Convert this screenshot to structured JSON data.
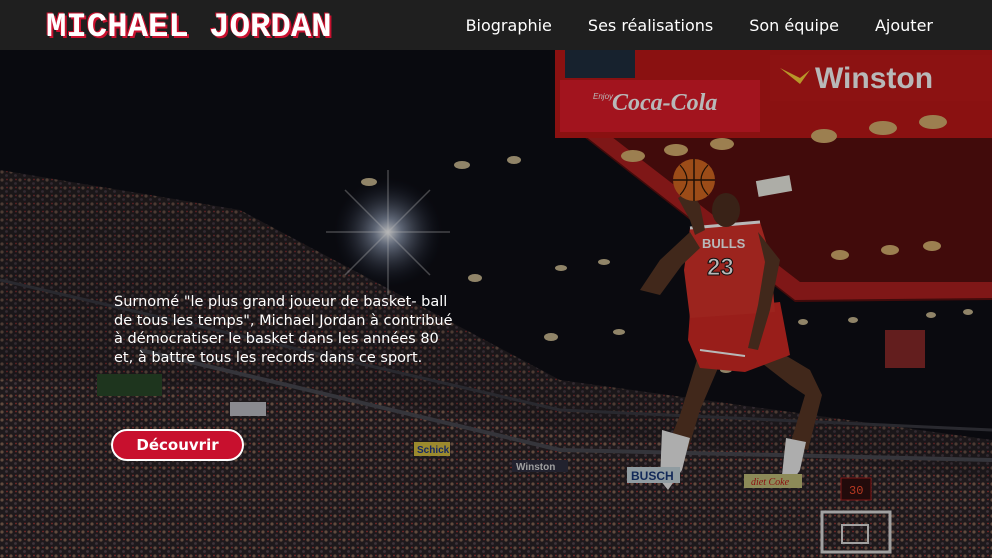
{
  "header": {
    "logo_text": "MICHAEL JORDAN",
    "nav": [
      {
        "label": "Biographie"
      },
      {
        "label": "Ses réalisations"
      },
      {
        "label": "Son équipe"
      },
      {
        "label": "Ajouter"
      }
    ]
  },
  "hero": {
    "description": "Surnomé \"le plus grand joueur de basket- ball de tous les temps\", Michael Jordan à contribué à démocratiser le basket dans les années 80 et, à battre tous les records dans ce sport.",
    "cta_label": "Découvrir",
    "image": {
      "signs": {
        "coca_cola": "Coca-Cola",
        "enjoy": "Enjoy",
        "winston": "Winston",
        "jersey_team": "BULLS",
        "jersey_number": "23",
        "schick": "Schick",
        "winston_small": "Winston",
        "busch": "BUSCH",
        "diet_coke": "diet Coke",
        "scoreboard": "30"
      }
    }
  },
  "colors": {
    "accent": "#c8102e",
    "navbar_bg": "#1f1f1f",
    "text": "#ffffff"
  }
}
